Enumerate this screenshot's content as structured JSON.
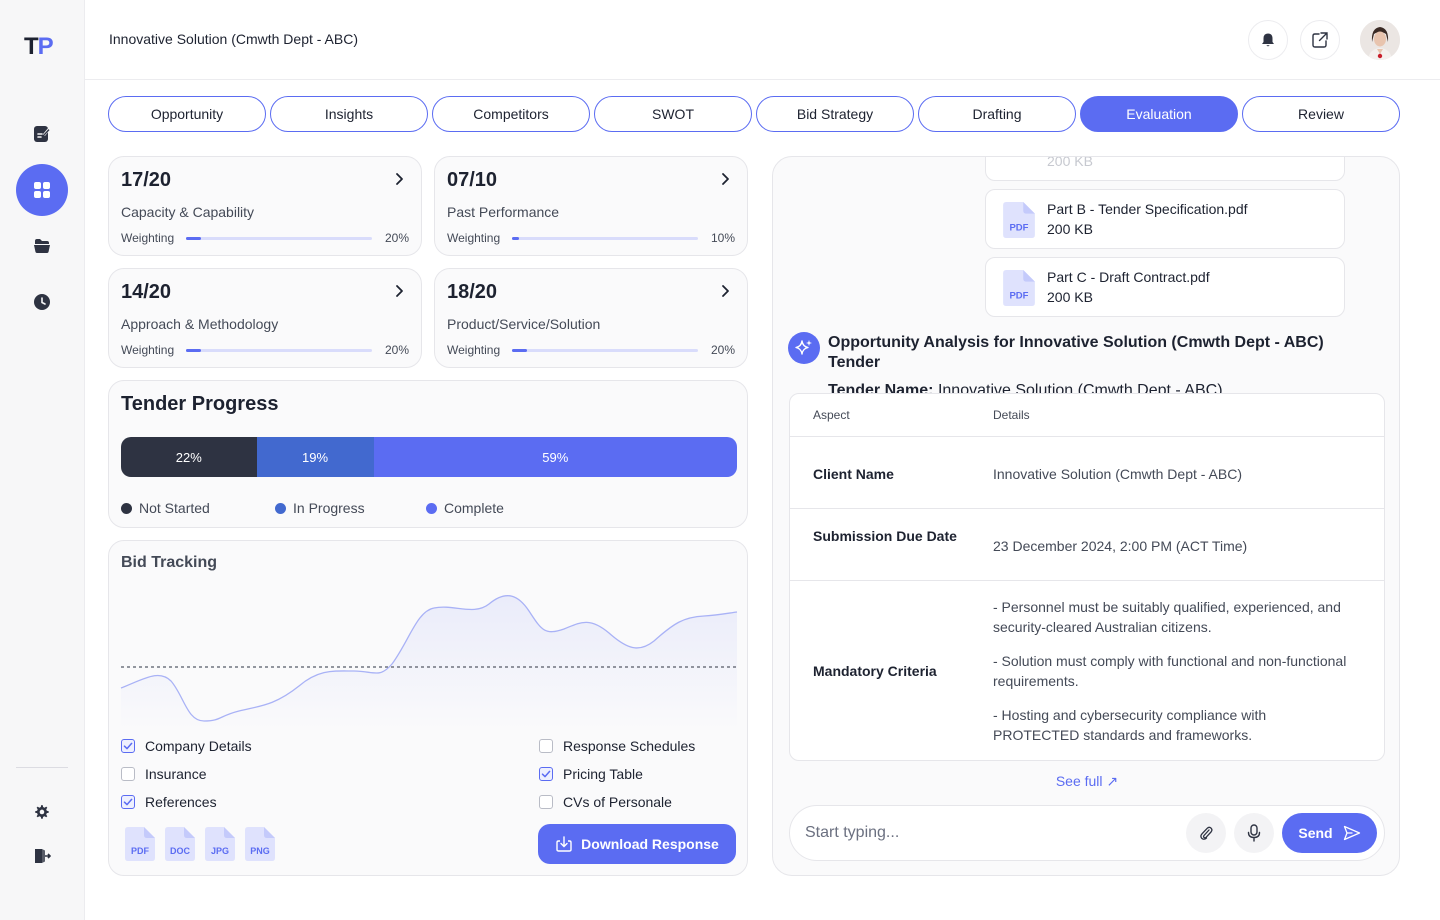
{
  "app": {
    "logo_t": "T",
    "logo_p": "P",
    "title": "Innovative Solution (Cmwth Dept - ABC)"
  },
  "sidebar": {
    "items": [
      {
        "icon": "edit-document-icon",
        "active": false
      },
      {
        "icon": "dashboard-grid-icon",
        "active": true
      },
      {
        "icon": "folder-icon",
        "active": false
      },
      {
        "icon": "clock-icon",
        "active": false
      }
    ],
    "bottom": [
      {
        "icon": "gear-icon"
      },
      {
        "icon": "logout-icon"
      }
    ]
  },
  "header": {
    "icons": [
      "bell-icon",
      "external-link-icon"
    ]
  },
  "tabs": [
    "Opportunity",
    "Insights",
    "Competitors",
    "SWOT",
    "Bid Strategy",
    "Drafting",
    "Evaluation",
    "Review"
  ],
  "active_tab": "Evaluation",
  "score_cards": [
    {
      "score": "17/20",
      "label": "Capacity & Capability",
      "weighting_label": "Weighting",
      "weighting": "20%",
      "weighting_value": 0.08
    },
    {
      "score": "07/10",
      "label": "Past Performance",
      "weighting_label": "Weighting",
      "weighting": "10%",
      "weighting_value": 0.04
    },
    {
      "score": "14/20",
      "label": "Approach & Methodology",
      "weighting_label": "Weighting",
      "weighting": "20%",
      "weighting_value": 0.08
    },
    {
      "score": "18/20",
      "label": "Product/Service/Solution",
      "weighting_label": "Weighting",
      "weighting": "20%",
      "weighting_value": 0.08
    }
  ],
  "tender_progress": {
    "title": "Tender Progress",
    "segments": [
      {
        "label": "22%",
        "value": 22,
        "color": "#2e3342"
      },
      {
        "label": "19%",
        "value": 19,
        "color": "#4269cf"
      },
      {
        "label": "59%",
        "value": 59,
        "color": "#5b6cf2"
      }
    ],
    "legend": [
      {
        "label": "Not Started",
        "color": "#2e3342"
      },
      {
        "label": "In Progress",
        "color": "#4269cf"
      },
      {
        "label": "Complete",
        "color": "#5b6cf2"
      }
    ]
  },
  "bid_tracking": {
    "title": "Bid Tracking",
    "checklist_left": [
      {
        "label": "Company Details",
        "checked": true
      },
      {
        "label": "Insurance",
        "checked": false
      },
      {
        "label": "References",
        "checked": true
      }
    ],
    "checklist_right": [
      {
        "label": "Response Schedules",
        "checked": false
      },
      {
        "label": "Pricing Table",
        "checked": true
      },
      {
        "label": "CVs of Personale",
        "checked": false
      }
    ],
    "file_types": [
      "PDF",
      "DOC",
      "JPG",
      "PNG"
    ],
    "download_label": "Download Response"
  },
  "chat": {
    "partial_size": "200 KB",
    "files": [
      {
        "name": "Part B - Tender Specification.pdf",
        "size": "200 KB",
        "type": "PDF"
      },
      {
        "name": "Part C - Draft Contract.pdf",
        "size": "200 KB",
        "type": "PDF"
      }
    ],
    "analysis_title": "Opportunity Analysis for Innovative Solution (Cmwth Dept - ABC) Tender",
    "tender_name_label": "Tender Name:",
    "tender_name_value": " Innovative Solution (Cmwth Dept - ABC)",
    "table": {
      "headers": [
        "Aspect",
        "Details"
      ],
      "rows": [
        {
          "aspect": "Client Name",
          "details": [
            "Innovative Solution (Cmwth Dept - ABC)"
          ]
        },
        {
          "aspect": "Submission Due Date",
          "details": [
            "23 December 2024, 2:00 PM (ACT Time)"
          ]
        },
        {
          "aspect": "Mandatory Criteria",
          "details": [
            "- Personnel must be suitably qualified, experienced, and security-cleared Australian citizens.",
            "- Solution must comply with functional and non-functional requirements.",
            "- Hosting and cybersecurity compliance with PROTECTED standards and frameworks."
          ]
        }
      ]
    },
    "see_full": "See full ↗",
    "input_placeholder": "Start typing...",
    "send_label": "Send"
  }
}
